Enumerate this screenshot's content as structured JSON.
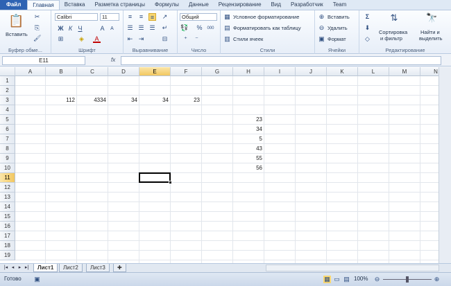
{
  "tabs": [
    "Файл",
    "Главная",
    "Вставка",
    "Разметка страницы",
    "Формулы",
    "Данные",
    "Рецензирование",
    "Вид",
    "Разработчик",
    "Team"
  ],
  "ribbon": {
    "clipboard": {
      "paste": "Вставить",
      "label": "Буфер обме..."
    },
    "font": {
      "name": "Calibri",
      "size": "11",
      "bold": "Ж",
      "italic": "К",
      "underline": "Ч",
      "grow": "A",
      "shrink": "A",
      "color_a": "A",
      "label": "Шрифт"
    },
    "alignment": {
      "label": "Выравнивание"
    },
    "number": {
      "format": "Общий",
      "pct": "%",
      "thousands": "000",
      "label": "Число"
    },
    "styles": {
      "cond": "Условное форматирование",
      "table": "Форматировать как таблицу",
      "cell": "Стили ячеек",
      "label": "Стили"
    },
    "cells": {
      "insert": "Вставить",
      "delete": "Удалить",
      "format": "Формат",
      "label": "Ячейки"
    },
    "editing": {
      "sum": "Σ",
      "sort1": "Сортировка",
      "sort2": "и фильтр",
      "find1": "Найти и",
      "find2": "выделить",
      "label": "Редактирование"
    }
  },
  "formula_bar": {
    "name_box": "E11",
    "fx": "fx",
    "value": ""
  },
  "columns": [
    "A",
    "B",
    "C",
    "D",
    "E",
    "F",
    "G",
    "H",
    "I",
    "J",
    "K",
    "L",
    "M",
    "N"
  ],
  "rows": [
    "1",
    "2",
    "3",
    "4",
    "5",
    "6",
    "7",
    "8",
    "9",
    "10",
    "11",
    "12",
    "13",
    "14",
    "15",
    "16",
    "17",
    "18",
    "19"
  ],
  "cells": {
    "B3": "112",
    "C3": "4334",
    "D3": "34",
    "E3": "34",
    "F3": "23",
    "H5": "23",
    "H6": "34",
    "H7": "5",
    "H8": "43",
    "H9": "55",
    "H10": "56"
  },
  "selected": {
    "column": "E",
    "row": "11"
  },
  "sheets": [
    "Лист1",
    "Лист2",
    "Лист3"
  ],
  "active_sheet": "Лист1",
  "status": {
    "ready": "Готово",
    "zoom": "100%"
  },
  "colors": {
    "file_tab": "#2e63b3",
    "selection_header": "#f2c760"
  }
}
